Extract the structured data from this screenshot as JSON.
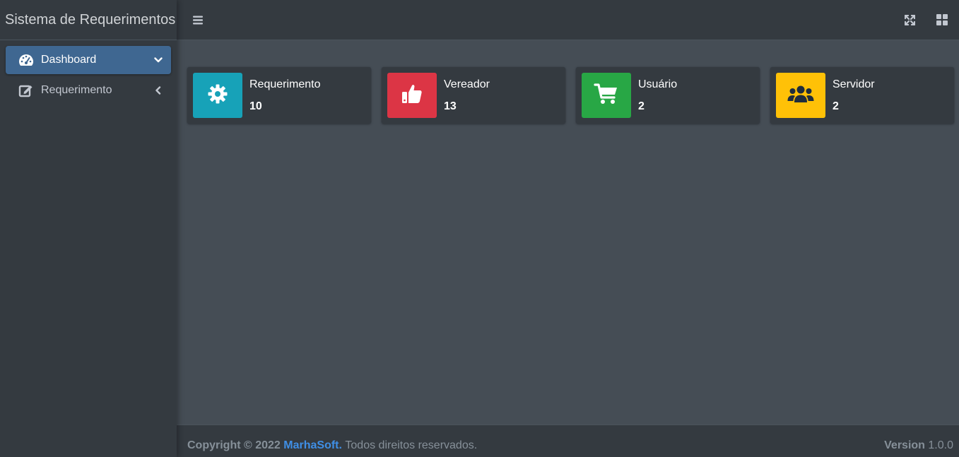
{
  "app": {
    "brand": "Sistema de Requerimentos"
  },
  "sidebar": {
    "items": [
      {
        "label": "Dashboard",
        "icon": "tachometer-icon",
        "chevron": "chevron-down-icon",
        "active": true
      },
      {
        "label": "Requerimento",
        "icon": "edit-icon",
        "chevron": "chevron-left-icon",
        "active": false
      }
    ]
  },
  "topbar": {
    "left_icon": "bars-icon",
    "right_icons": [
      "expand-icon",
      "th-large-icon"
    ]
  },
  "info_boxes": [
    {
      "text": "Requerimento",
      "number": "10",
      "color": "#17a2b8",
      "icon": "cog-icon"
    },
    {
      "text": "Vereador",
      "number": "13",
      "color": "#dc3545",
      "icon": "thumbs-up-icon"
    },
    {
      "text": "Usuário",
      "number": "2",
      "color": "#28a745",
      "icon": "shopping-cart-icon"
    },
    {
      "text": "Servidor",
      "number": "2",
      "color": "#ffc107",
      "icon": "users-icon"
    }
  ],
  "footer": {
    "copyright": "Copyright © 2022",
    "company": "MarhaSoft.",
    "rights": "Todos direitos reservados.",
    "version_label": "Version",
    "version_value": "1.0.0"
  }
}
